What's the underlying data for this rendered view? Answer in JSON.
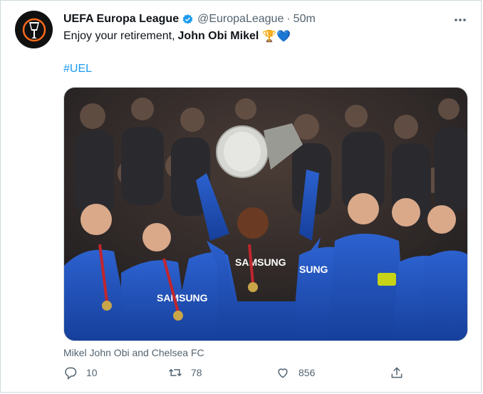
{
  "account": {
    "name": "UEFA Europa League",
    "handle": "@EuropaLeague",
    "separator": "·",
    "time": "50m"
  },
  "tweet": {
    "text_prefix": "Enjoy your retirement,",
    "bold_name": "John Obi Mikel",
    "emoji": "🏆💙",
    "hashtag": "#UEL"
  },
  "media": {
    "caption": "Mikel John Obi and Chelsea FC"
  },
  "actions": {
    "replies": "10",
    "retweets": "78",
    "likes": "856"
  },
  "colors": {
    "link": "#1d9bf0",
    "verified": "#1d9bf0",
    "muted": "#536471",
    "kit_blue": "#1e4fb7",
    "trophy_silver": "#d6d6d2",
    "crowd_dark": "#2a2a2e"
  },
  "icons": [
    "verified-badge-icon",
    "more-options-icon",
    "reply-icon",
    "retweet-icon",
    "like-icon",
    "share-icon"
  ]
}
